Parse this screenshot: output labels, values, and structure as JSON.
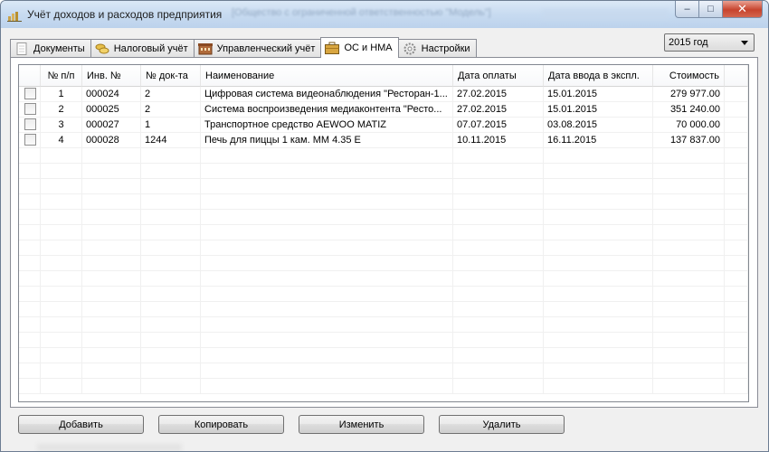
{
  "window": {
    "title": "Учёт доходов и расходов предприятия",
    "title_extra": "[Общество с ограниченной ответственностью \"Модель\"]",
    "minimize": "–",
    "maximize": "□",
    "close": "✕"
  },
  "tabs": [
    {
      "label": "Документы",
      "icon": "document-icon",
      "active": false
    },
    {
      "label": "Налоговый учёт",
      "icon": "coins-icon",
      "active": false
    },
    {
      "label": "Управленческий учёт",
      "icon": "building-icon",
      "active": false
    },
    {
      "label": "ОС и НМА",
      "icon": "briefcase-icon",
      "active": true
    },
    {
      "label": "Настройки",
      "icon": "gear-icon",
      "active": false
    }
  ],
  "year_select": {
    "value": "2015 год"
  },
  "table": {
    "headers": [
      "",
      "№ п/п",
      "Инв. №",
      "№ док-та",
      "Наименование",
      "Дата оплаты",
      "Дата ввода в экспл.",
      "Стоимость"
    ],
    "rows": [
      [
        "1",
        "000024",
        "2",
        "Цифровая система видеонаблюдения \"Ресторан-1...",
        "27.02.2015",
        "15.01.2015",
        "279 977.00"
      ],
      [
        "2",
        "000025",
        "2",
        "Система воспроизведения медиаконтента \"Ресто...",
        "27.02.2015",
        "15.01.2015",
        "351 240.00"
      ],
      [
        "3",
        "000027",
        "1",
        "Транспортное средство AEWOO MATIZ",
        "07.07.2015",
        "03.08.2015",
        "70 000.00"
      ],
      [
        "4",
        "000028",
        "1244",
        "Печь для пиццы 1 кам. ММ 4.35 Е",
        "10.11.2015",
        "16.11.2015",
        "137 837.00"
      ]
    ]
  },
  "buttons": {
    "add": "Добавить",
    "copy": "Копировать",
    "edit": "Изменить",
    "delete": "Удалить"
  }
}
